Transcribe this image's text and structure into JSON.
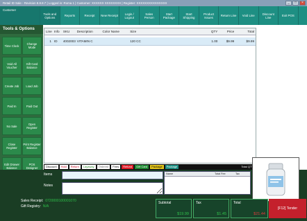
{
  "window": {
    "title": "Retail ID Sale - Revision 8.8.8.7 | Logged in: Roma 1 | Customer: XXXXXX XXXXXXXX | Register: XXXXXXXXXXXXXXX",
    "controls": [
      "_",
      "□",
      "×"
    ]
  },
  "toolbar": {
    "customer": "Customer",
    "buttons": [
      "Tools and Options",
      "Reports",
      "Receipt",
      "New Receipt",
      "Login / Logout",
      "Sales Person",
      "Start Package",
      "Start Shipping",
      "Product Issues",
      "Return Line",
      "Void Line",
      "Discount Line",
      "Exit POS"
    ]
  },
  "tools_panel": {
    "title": "Tools & Options",
    "buttons": [
      {
        "label": "Time Clock",
        "col": 0,
        "row": 0
      },
      {
        "label": "Change Mode",
        "col": 1,
        "row": 0
      },
      {
        "label": "Void All Voucher",
        "col": 0,
        "row": 1
      },
      {
        "label": "Gift Card Balance",
        "col": 1,
        "row": 1
      },
      {
        "label": "Create Job",
        "col": 0,
        "row": 2
      },
      {
        "label": "Load Job",
        "col": 1,
        "row": 2
      },
      {
        "label": "Paid In",
        "col": 0,
        "row": 3
      },
      {
        "label": "Paid Out",
        "col": 1,
        "row": 3
      },
      {
        "label": "No Sale",
        "col": 0,
        "row": 4
      },
      {
        "label": "Open Register",
        "col": 1,
        "row": 4
      },
      {
        "label": "Close Register",
        "col": 0,
        "row": 5
      },
      {
        "label": "Print Register Balance",
        "col": 1,
        "row": 5
      },
      {
        "label": "Edit Drawer Balance",
        "col": 0,
        "row": 6
      },
      {
        "label": "POS Designer",
        "col": 1,
        "row": 6
      }
    ]
  },
  "grid": {
    "columns": [
      "Line",
      "Info",
      "SKU",
      "Description",
      "Color Name",
      "Size",
      "",
      "QTY",
      "Price",
      "Total"
    ],
    "rows": [
      [
        "1",
        "ID",
        "40020031...",
        "VITAMIN C",
        "",
        "120 CC",
        "",
        "1.00",
        "$9.99",
        "$9.99"
      ]
    ]
  },
  "legend": {
    "items": [
      {
        "label": "Discount",
        "cls": "lg-discount"
      },
      {
        "label": "Hold",
        "cls": "lg-hold"
      },
      {
        "label": "Return",
        "cls": "lg-return"
      },
      {
        "label": "Layaway",
        "cls": "lg-layaway"
      },
      {
        "label": "Ordered",
        "cls": "lg-ordered"
      },
      {
        "label": "Fees",
        "cls": "lg-fees"
      },
      {
        "label": "Refund",
        "cls": "lg-refund"
      },
      {
        "label": "Gift Card",
        "cls": "lg-gift"
      },
      {
        "label": "Package",
        "cls": "lg-package"
      },
      {
        "label": "Package",
        "cls": "lg-pkg2"
      }
    ],
    "total_qty_label": "Total QTY:"
  },
  "fields": {
    "items_label": "Items",
    "notes_label": "Notes"
  },
  "mini_table": {
    "columns": [
      "Name",
      "Total Fee",
      "Tax"
    ]
  },
  "sales_info": {
    "receipt_label": "Sales Receipt:",
    "receipt_value": "0720000100001070",
    "gift_label": "Gift Registry:",
    "gift_value": "N/A"
  },
  "totals": {
    "subtotal_label": "Subtotal",
    "subtotal_value": "$19.99",
    "tax_label": "Tax",
    "tax_value": "$1.45",
    "total_label": "Total",
    "total_value": "$21.44"
  },
  "tender": {
    "label": "[F12] Tender"
  }
}
